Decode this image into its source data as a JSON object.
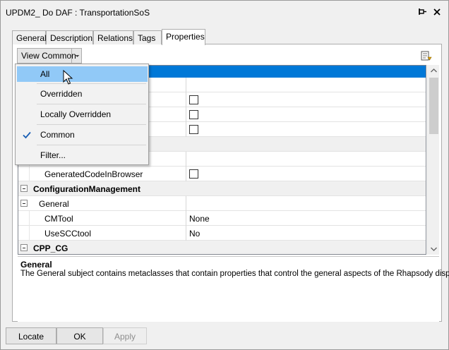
{
  "window": {
    "title": "UPDM2_ Do DAF : TransportationSoS"
  },
  "tabs": [
    {
      "label": "General"
    },
    {
      "label": "Description"
    },
    {
      "label": "Relations"
    },
    {
      "label": "Tags"
    },
    {
      "label": "Properties"
    }
  ],
  "active_tab": "Properties",
  "view_combo": {
    "label": "View Common"
  },
  "menu": {
    "items": [
      {
        "label": "All",
        "highlighted": true,
        "checked": false
      },
      {
        "label": "Overridden",
        "highlighted": false,
        "checked": false
      },
      {
        "label": "Locally Overridden",
        "highlighted": false,
        "checked": false
      },
      {
        "label": "Common",
        "highlighted": false,
        "checked": true
      },
      {
        "label": "Filter...",
        "highlighted": false,
        "checked": false
      }
    ]
  },
  "grid": {
    "rows": [
      {
        "name": "GeneratedCodeInBrowser",
        "value": "",
        "checkbox": true
      },
      {
        "name": "ConfigurationManagement",
        "value": "",
        "bold": true,
        "collapsible": true
      },
      {
        "name": "General",
        "value": "",
        "collapsible": true
      },
      {
        "name": "CMTool",
        "value": "None"
      },
      {
        "name": "UseSCCtool",
        "value": "No"
      },
      {
        "name": "CPP_CG",
        "value": "",
        "bold": true,
        "collapsible": true
      }
    ]
  },
  "description": {
    "title": "General",
    "text": "The General subject contains metaclasses that contain properties that control the general aspects of the Rhapsody display."
  },
  "buttons": {
    "locate": "Locate",
    "ok": "OK",
    "apply": "Apply"
  },
  "colors": {
    "selection": "#0078d7",
    "menu_highlight": "#91c9f7"
  }
}
